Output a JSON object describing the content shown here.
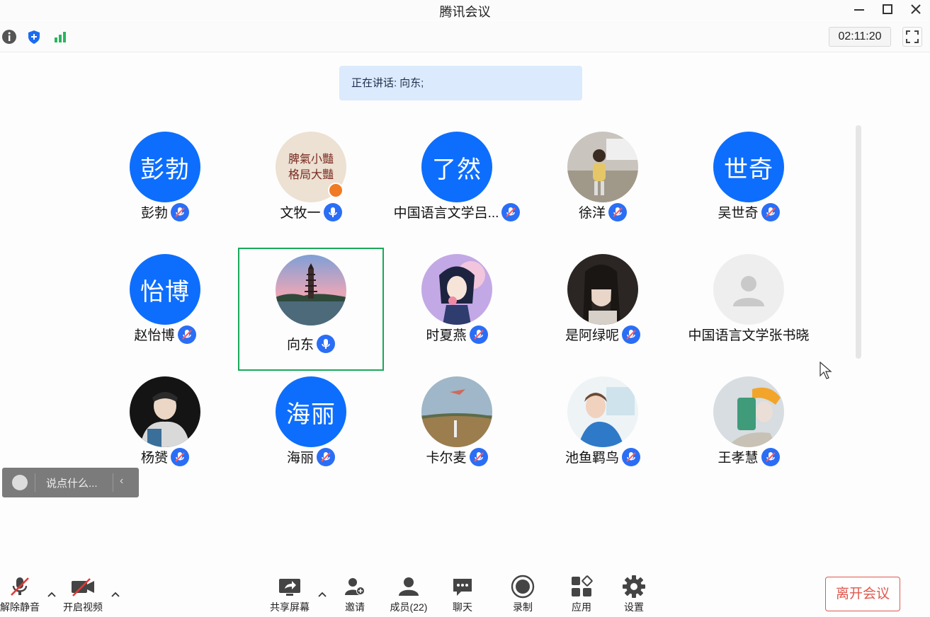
{
  "window": {
    "title": "腾讯会议"
  },
  "infobar": {
    "timer": "02:11:20"
  },
  "speaking": {
    "prefix": "正在讲话:",
    "name": "向东;"
  },
  "participants": [
    {
      "name": "彭勃",
      "avatar_text": "彭勃"
    },
    {
      "name": "文牧一",
      "avatar_text": ""
    },
    {
      "name": "中国语言文学吕...",
      "avatar_text": "了然"
    },
    {
      "name": "徐洋",
      "avatar_text": ""
    },
    {
      "name": "吴世奇",
      "avatar_text": "世奇"
    },
    {
      "name": "赵怡博",
      "avatar_text": "怡博"
    },
    {
      "name": "向东",
      "avatar_text": ""
    },
    {
      "name": "时夏燕",
      "avatar_text": ""
    },
    {
      "name": "是阿绿呢",
      "avatar_text": ""
    },
    {
      "name": "中国语言文学张书晓",
      "avatar_text": ""
    },
    {
      "name": "杨赟",
      "avatar_text": ""
    },
    {
      "name": "海丽",
      "avatar_text": "海丽"
    },
    {
      "name": "卡尔麦",
      "avatar_text": ""
    },
    {
      "name": "池鱼羁鸟",
      "avatar_text": ""
    },
    {
      "name": "王孝慧",
      "avatar_text": ""
    }
  ],
  "avatar_logo_text": {
    "line1": "脾氣小豔",
    "line2": "格局大豔"
  },
  "chat": {
    "placeholder": "说点什么...",
    "collapse": "‹"
  },
  "toolbar": {
    "unmute": "解除静音",
    "video": "开启视频",
    "share": "共享屏幕",
    "invite": "邀请",
    "members": "成员(22)",
    "chat": "聊天",
    "record": "录制",
    "apps": "应用",
    "settings": "设置",
    "leave": "离开会议"
  },
  "colors": {
    "accent": "#0d6efd",
    "active_border": "#1aa85a",
    "leave": "#e0584d",
    "signal": "#2ab55f"
  }
}
